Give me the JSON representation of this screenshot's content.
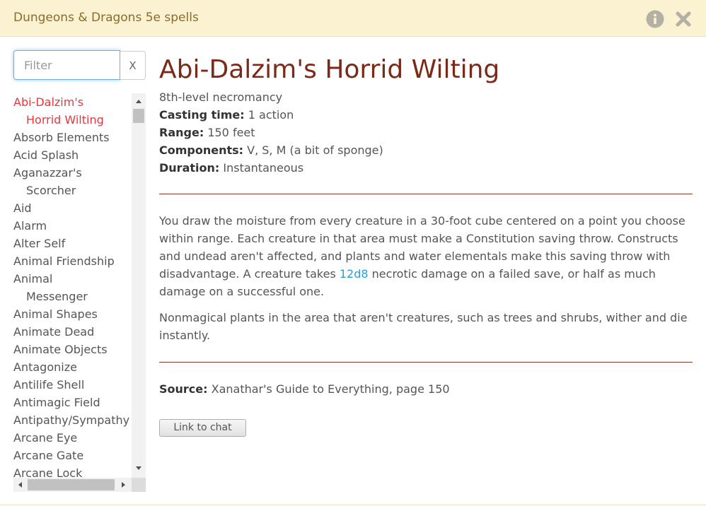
{
  "window": {
    "title": "Dungeons & Dragons 5e spells",
    "icons": {
      "info": "info-icon",
      "close": "close-icon"
    }
  },
  "sidebar": {
    "filter_placeholder": "Filter",
    "filter_value": "",
    "clear_label": "X",
    "spells": [
      "Abi-Dalzim's Horrid Wilting",
      "Absorb Elements",
      "Acid Splash",
      "Aganazzar's Scorcher",
      "Aid",
      "Alarm",
      "Alter Self",
      "Animal Friendship",
      "Animal Messenger",
      "Animal Shapes",
      "Animate Dead",
      "Animate Objects",
      "Antagonize",
      "Antilife Shell",
      "Antimagic Field",
      "Antipathy/Sympathy",
      "Arcane Eye",
      "Arcane Gate",
      "Arcane Lock"
    ],
    "selected_index": 0
  },
  "spell": {
    "name": "Abi-Dalzim's Horrid Wilting",
    "level_school": "8th-level necromancy",
    "casting_time_label": "Casting time:",
    "casting_time": "1 action",
    "range_label": "Range:",
    "range": "150 feet",
    "components_label": "Components:",
    "components": "V, S, M (a bit of sponge)",
    "duration_label": "Duration:",
    "duration": "Instantaneous",
    "desc1_before": "You draw the moisture from every creature in a 30-foot cube centered on a point you choose within range. Each creature in that area must make a Constitution saving throw. Constructs and undead aren't affected, and plants and water elementals make this saving throw with disadvantage. A creature takes ",
    "desc1_dice": "12d8",
    "desc1_after": " necrotic damage on a failed save, or half as much damage on a successful one.",
    "desc2": "Nonmagical plants in the area that aren't creatures, such as trees and shrubs, wither and die instantly.",
    "source_label": "Source:",
    "source": "Xanathar's Guide to Everything, page 150",
    "link_button": "Link to chat"
  },
  "colors": {
    "titlebar_bg": "#fbf2d1",
    "title_text": "#8a6b2a",
    "spell_name": "#7a2a17",
    "selected_spell": "#e0393e",
    "dice_link": "#2a9fd6",
    "rule": "#8b3a2a"
  }
}
